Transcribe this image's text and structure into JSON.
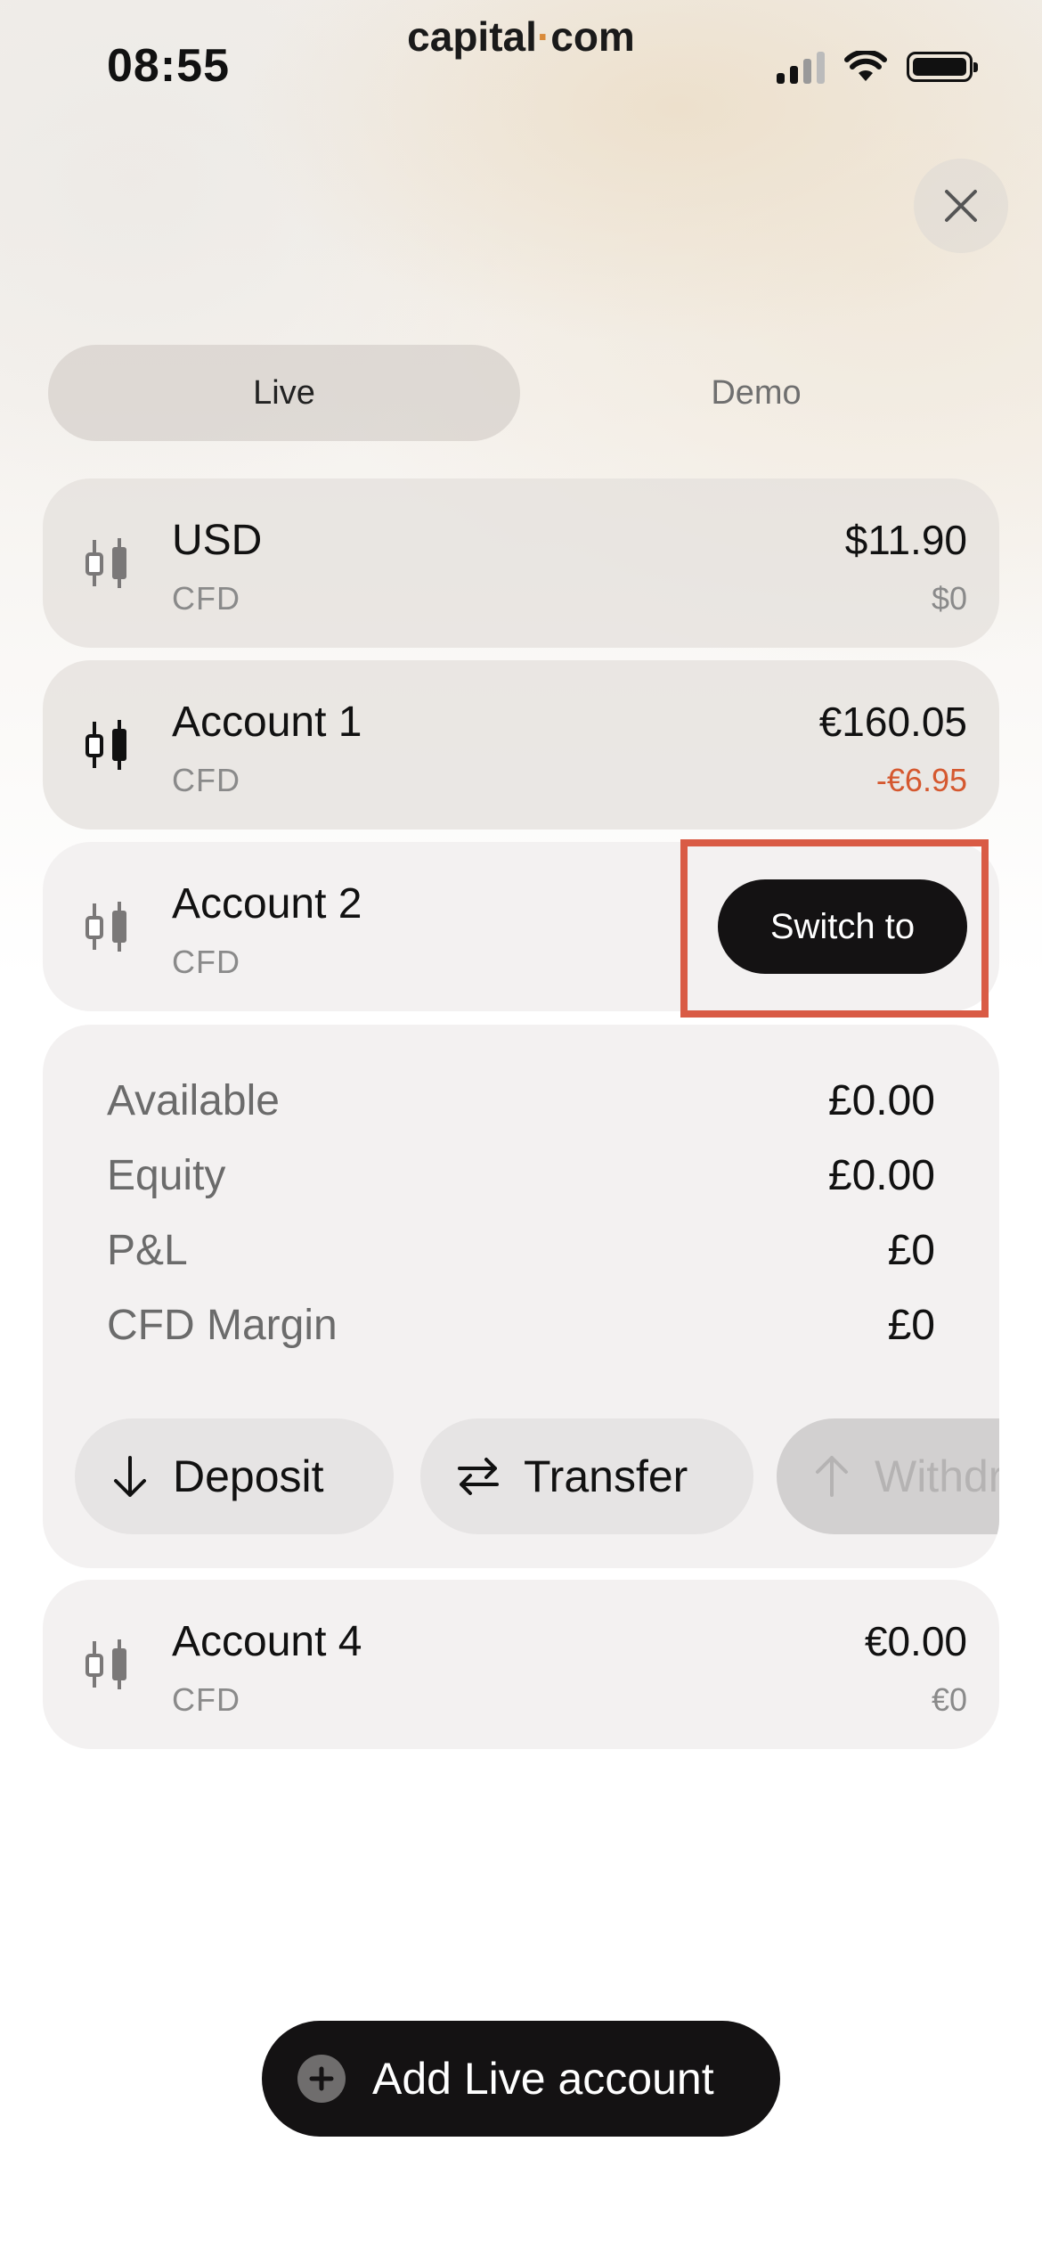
{
  "status_bar": {
    "time": "08:55"
  },
  "brand": {
    "left": "capital",
    "dot": "·",
    "right": "com"
  },
  "tabs": {
    "live": "Live",
    "demo": "Demo"
  },
  "accounts": [
    {
      "name": "USD",
      "type": "CFD",
      "balance": "$11.90",
      "pl": "$0"
    },
    {
      "name": "Account 1",
      "type": "CFD",
      "balance": "€160.05",
      "pl": "-€6.95"
    },
    {
      "name": "Account 2",
      "type": "CFD",
      "action": "Switch to"
    },
    {
      "name": "Account 4",
      "type": "CFD",
      "balance": "€0.00",
      "pl": "€0"
    }
  ],
  "account_details": {
    "rows": [
      {
        "label": "Available",
        "value": "£0.00"
      },
      {
        "label": "Equity",
        "value": "£0.00"
      },
      {
        "label": "P&L",
        "value": "£0"
      },
      {
        "label": "CFD Margin",
        "value": "£0"
      }
    ],
    "actions": {
      "deposit": "Deposit",
      "transfer": "Transfer",
      "withdraw": "Withdraw"
    }
  },
  "add_account": {
    "label": "Add Live account"
  },
  "colors": {
    "negative": "#d5582f",
    "highlight": "#d95b45",
    "brand_dot": "#d98b3a",
    "dark_button": "#141213"
  },
  "icons": [
    "candlestick-icon",
    "close-icon",
    "arrow-down-icon",
    "transfer-icon",
    "arrow-up-icon",
    "plus-circle-icon",
    "signal-icon",
    "wifi-icon",
    "battery-icon"
  ]
}
